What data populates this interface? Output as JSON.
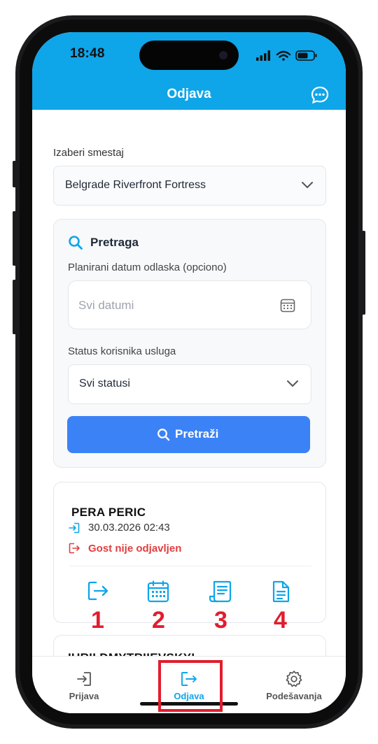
{
  "status_bar": {
    "time": "18:48"
  },
  "header": {
    "title": "Odjava"
  },
  "accommodation": {
    "label": "Izaberi smestaj",
    "selected": "Belgrade Riverfront Fortress"
  },
  "search": {
    "title": "Pretraga",
    "date_label": "Planirani datum odlaska (opciono)",
    "date_placeholder": "Svi datumi",
    "status_label": "Status korisnika usluga",
    "status_selected": "Svi statusi",
    "button_label": "Pretraži"
  },
  "guests": [
    {
      "name": "PERA PERIC",
      "checkin": "30.03.2026 02:43",
      "status": "Gost nije odjavljen"
    },
    {
      "name": "IURII DMYTRIIEVSKYI"
    }
  ],
  "annotations": [
    "1",
    "2",
    "3",
    "4"
  ],
  "nav": {
    "items": [
      {
        "label": "Prijava"
      },
      {
        "label": "Odjava"
      },
      {
        "label": "Podešavanja"
      }
    ],
    "active_color": "#0ea5e9"
  },
  "colors": {
    "header": "#0ea5e9",
    "primary_button": "#3b82f6",
    "alert": "#e03e3e",
    "annotation": "#e11d2e"
  }
}
